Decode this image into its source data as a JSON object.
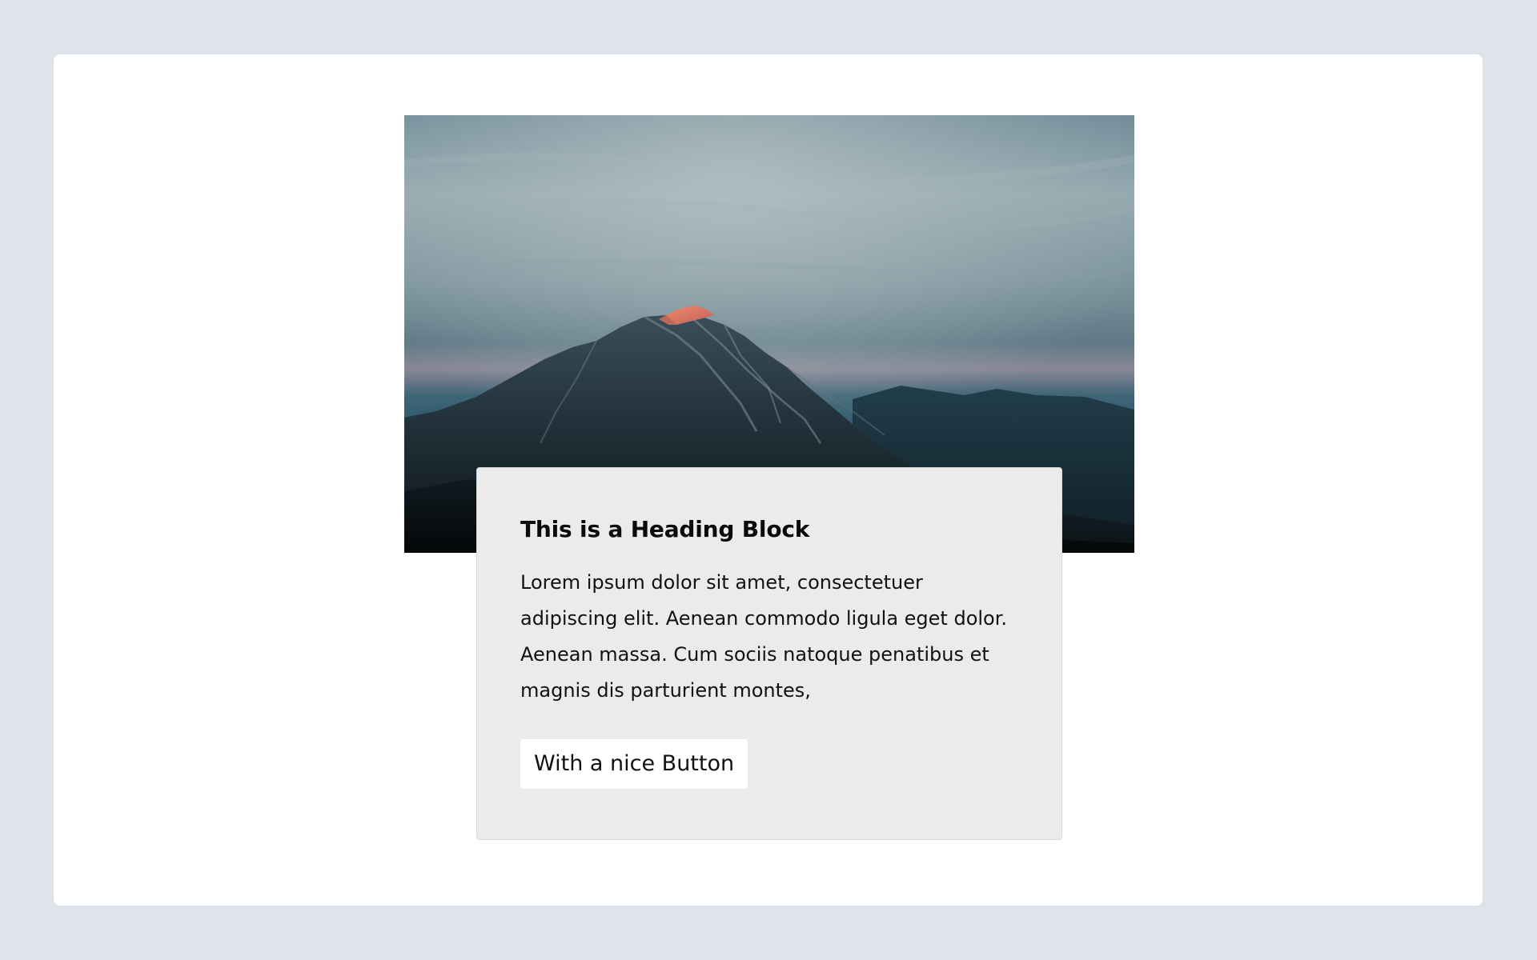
{
  "card": {
    "heading": "This is a Heading Block",
    "body": "Lorem ipsum dolor sit amet, consectetuer adipiscing elit. Aenean commodo ligula eget dolor. Aenean massa. Cum sociis natoque penatibus et magnis dis parturient montes,",
    "button_label": "With a nice Button"
  },
  "hero_image": {
    "subject": "mountain-peak-at-dusk-photo"
  },
  "colors": {
    "page_background": "#dfe3ea",
    "panel_background": "#ffffff",
    "card_background": "#ebebeb",
    "button_background": "#ffffff"
  }
}
